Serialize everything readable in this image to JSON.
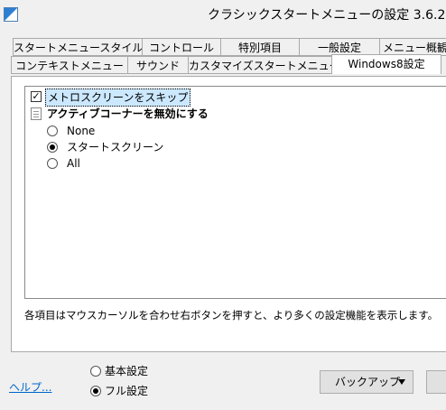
{
  "window": {
    "title": "クラシックスタートメニューの設定 3.6.2"
  },
  "tabs": {
    "row1": [
      "スタートメニュースタイル",
      "コントロール",
      "特別項目",
      "一般設定",
      "メニュー概観"
    ],
    "row2": [
      "コンテキストメニュー",
      "サウンド",
      "カスタマイズスタートメニュー",
      "Windows8設定"
    ],
    "active": "Windows8設定"
  },
  "settings": {
    "skip_metro": {
      "label": "メトロスクリーンをスキップ",
      "checked": true
    },
    "active_corners": {
      "label": "アクティブコーナーを無効にする",
      "options": [
        {
          "label": "None",
          "selected": false
        },
        {
          "label": "スタートスクリーン",
          "selected": true
        },
        {
          "label": "All",
          "selected": false
        }
      ]
    }
  },
  "hint": "各項目はマウスカーソルを合わせ右ボタンを押すと、より多くの設定機能を表示します。",
  "footer": {
    "help_link": "ヘルプ...",
    "mode_basic": "基本設定",
    "mode_full": "フル設定",
    "mode_selected": "フル設定",
    "backup_button": "バックアップ"
  }
}
